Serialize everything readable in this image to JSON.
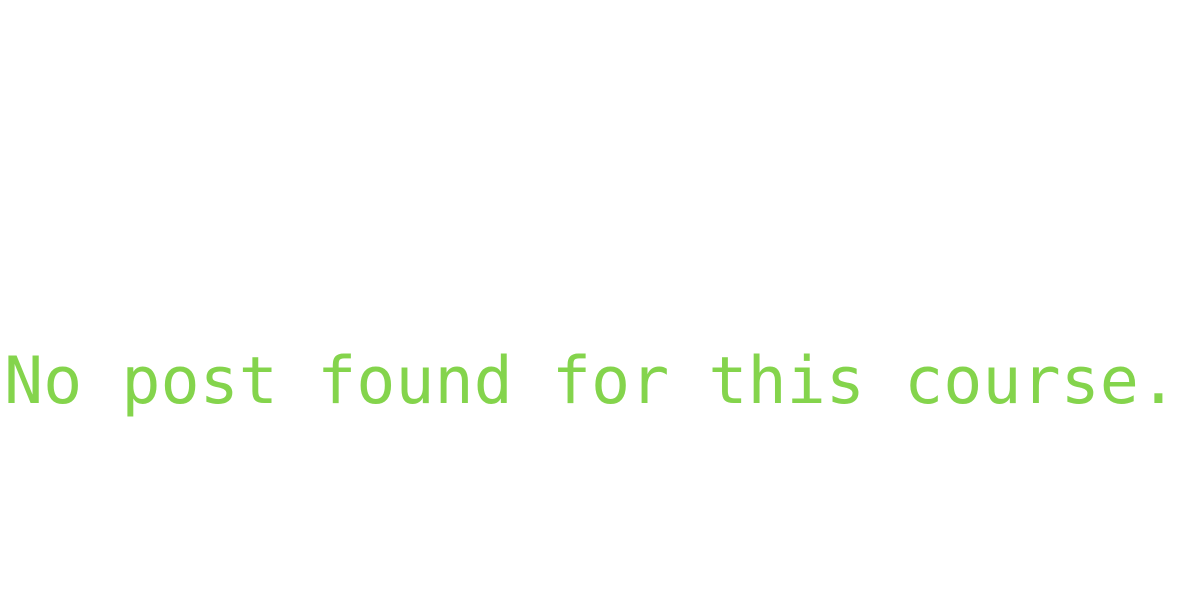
{
  "empty_state": {
    "message": "No post found for this course.",
    "color": "#84d44c"
  }
}
